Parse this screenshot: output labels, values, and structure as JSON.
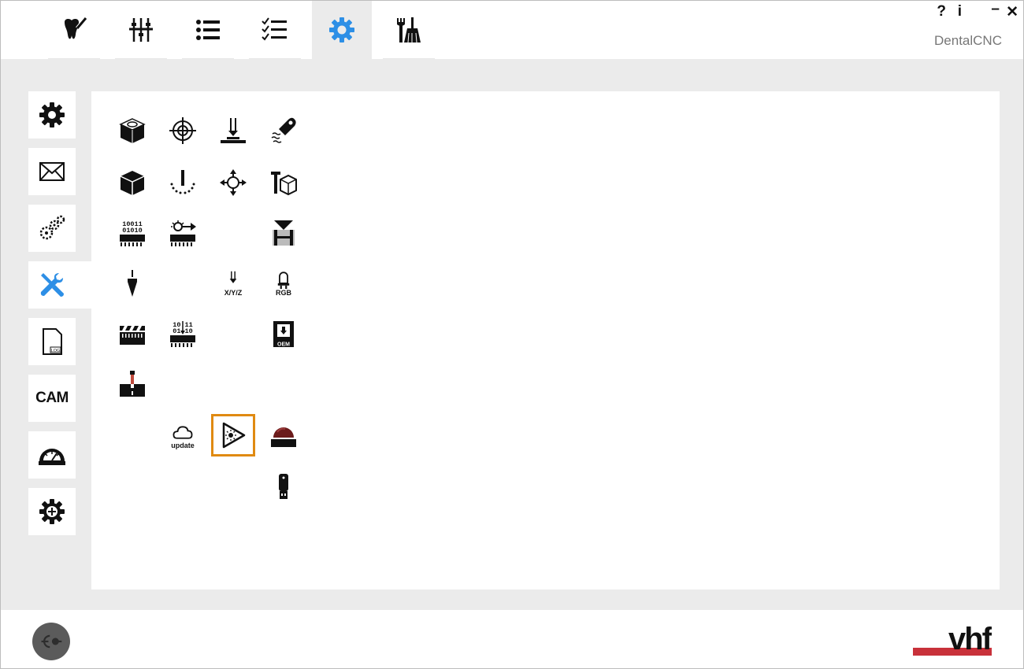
{
  "app": {
    "brand": "DentalCNC",
    "help_label": "?",
    "info_label": "i",
    "minimize_label": "–",
    "close_label": "✕"
  },
  "top_tabs": [
    {
      "icon": "tooth-tool-icon",
      "active": false
    },
    {
      "icon": "sliders-icon",
      "active": false
    },
    {
      "icon": "list-icon",
      "active": false
    },
    {
      "icon": "checklist-icon",
      "active": false
    },
    {
      "icon": "gear-icon",
      "active": true
    },
    {
      "icon": "tools-broom-icon",
      "active": false
    }
  ],
  "sidebar": {
    "items": [
      {
        "icon": "gear-icon"
      },
      {
        "icon": "envelope-icon"
      },
      {
        "icon": "multi-gear-icon"
      },
      {
        "icon": "wrench-screwdriver-icon",
        "active": true
      },
      {
        "icon": "log-file-icon",
        "label": "LOG"
      },
      {
        "icon": "cam-icon",
        "label": "CAM"
      },
      {
        "icon": "gauge-icon"
      },
      {
        "icon": "gear-plus-icon"
      }
    ]
  },
  "tools": {
    "xyz_label": "X/Y/Z",
    "rgb_label": "RGB",
    "oem_label": "OEM",
    "update_label": "update",
    "binary_top": "10011",
    "binary_bottom": "01010",
    "binary2_top": "10 11",
    "binary2_bottom": "01 10"
  },
  "colors": {
    "accent": "#2d8fe6",
    "selected_border": "#e08a12",
    "brand_red": "#c8313a",
    "dark_red": "#6b1b1b"
  }
}
